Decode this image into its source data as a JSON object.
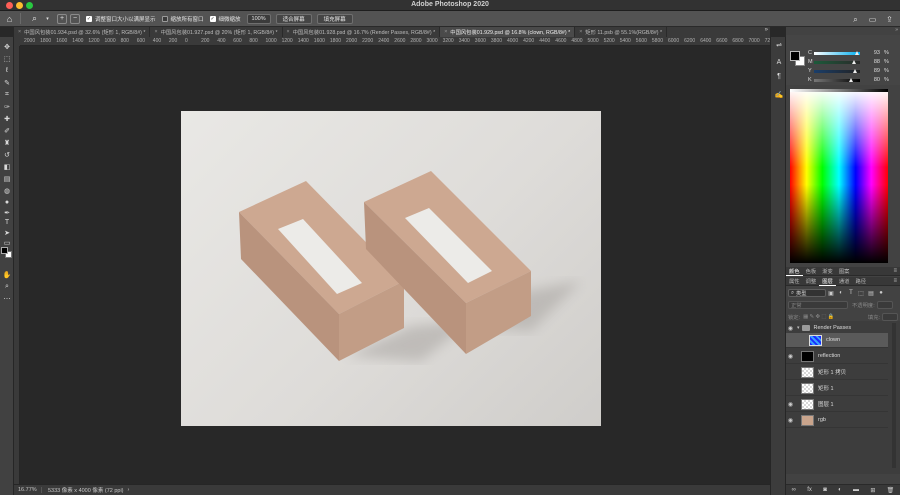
{
  "app": {
    "title": "Adobe Photoshop 2020"
  },
  "options": {
    "check_resize": "调整窗口大小以满屏显示",
    "check_all_windows": "缩放所有窗口",
    "check_scrubby": "细微缩放",
    "zoom_value": "100%",
    "fit_label": "适合屏幕",
    "fill_label": "填充屏幕"
  },
  "tabs": [
    {
      "label": "中国风包装01.934.psd @ 32.6% (矩形 1, RGB/8#) *"
    },
    {
      "label": "中国风包装01.927.psd @ 20% (矩形 1, RGB/8#) *"
    },
    {
      "label": "中国风包装01.928.psd @ 16.7% (Render Passes, RGB/8#) *"
    },
    {
      "label": "中国风包装01.929.psd @ 16.8% (clown, RGB/8#) *"
    },
    {
      "label": "矩形 11.psb @ 55.1%(RGB/8#) *"
    }
  ],
  "ruler": {
    "ticks": [
      "2000",
      "1800",
      "1600",
      "1400",
      "1200",
      "1000",
      "800",
      "600",
      "400",
      "200",
      "0",
      "200",
      "400",
      "600",
      "800",
      "1000",
      "1200",
      "1400",
      "1600",
      "1800",
      "2000",
      "2200",
      "2400",
      "2600",
      "2800",
      "3000",
      "3200",
      "3400",
      "3600",
      "3800",
      "4000",
      "4200",
      "4400",
      "4600",
      "4800",
      "5000",
      "5200",
      "5400",
      "5600",
      "5800",
      "6000",
      "6200",
      "6400",
      "6600",
      "6800",
      "7000",
      "720"
    ]
  },
  "status": {
    "zoom": "16.77%",
    "doc_info": "5333 像素 x 4000 像素 (72 ppi)"
  },
  "color_panel": {
    "sliders": [
      {
        "label": "C",
        "value": "93",
        "pos": 0.93
      },
      {
        "label": "M",
        "value": "88",
        "pos": 0.88
      },
      {
        "label": "Y",
        "value": "89",
        "pos": 0.89
      },
      {
        "label": "K",
        "value": "80",
        "pos": 0.8
      }
    ],
    "percent": "%",
    "tabs": [
      "颜色",
      "色板",
      "渐变",
      "图案"
    ]
  },
  "layers_panel": {
    "tabs": [
      "属性",
      "调整",
      "图层",
      "通道",
      "路径"
    ],
    "filter_label": "类型",
    "blend_label": "正常",
    "opacity_label": "不透明度:",
    "lock_label": "锁定:",
    "fill_label": "填充:",
    "layers": [
      {
        "name": "Render Passes",
        "type": "group",
        "visible": true
      },
      {
        "name": "clown",
        "type": "blue",
        "visible": false,
        "selected": true,
        "indent": true
      },
      {
        "name": "reflection",
        "type": "black",
        "visible": true
      },
      {
        "name": "矩形 1 拷贝",
        "type": "checker",
        "visible": false
      },
      {
        "name": "矩形 1",
        "type": "checker",
        "visible": false
      },
      {
        "name": "图层 1",
        "type": "checker",
        "visible": true
      },
      {
        "name": "rgb",
        "type": "peach",
        "visible": true
      }
    ]
  },
  "colors": {
    "box_top": "#cda891",
    "box_left": "#b9937d",
    "box_right": "#c29d86",
    "label": "#ecebe8"
  }
}
